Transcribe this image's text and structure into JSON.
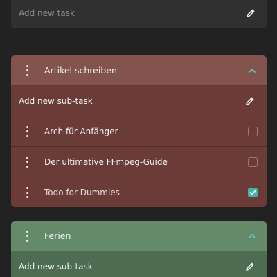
{
  "top": {
    "placeholder": "Add new task",
    "icon": "pencil-icon"
  },
  "groups": [
    {
      "title": "Artikel schreiben",
      "color": "#83534e",
      "expanded": true,
      "subtask_placeholder": "Add new sub-task",
      "tasks": [
        {
          "label": "Arch für Anfänger",
          "done": false
        },
        {
          "label": "Der ultimative FFmpeg-Guide",
          "done": false
        },
        {
          "label": "Todo for Dummies",
          "done": true
        }
      ]
    },
    {
      "title": "Ferien",
      "color": "#648a6a",
      "expanded": true,
      "subtask_placeholder": "Add new sub-task",
      "tasks": []
    }
  ],
  "colors": {
    "background": "#222222",
    "check_accent": "#3fb3a6"
  }
}
